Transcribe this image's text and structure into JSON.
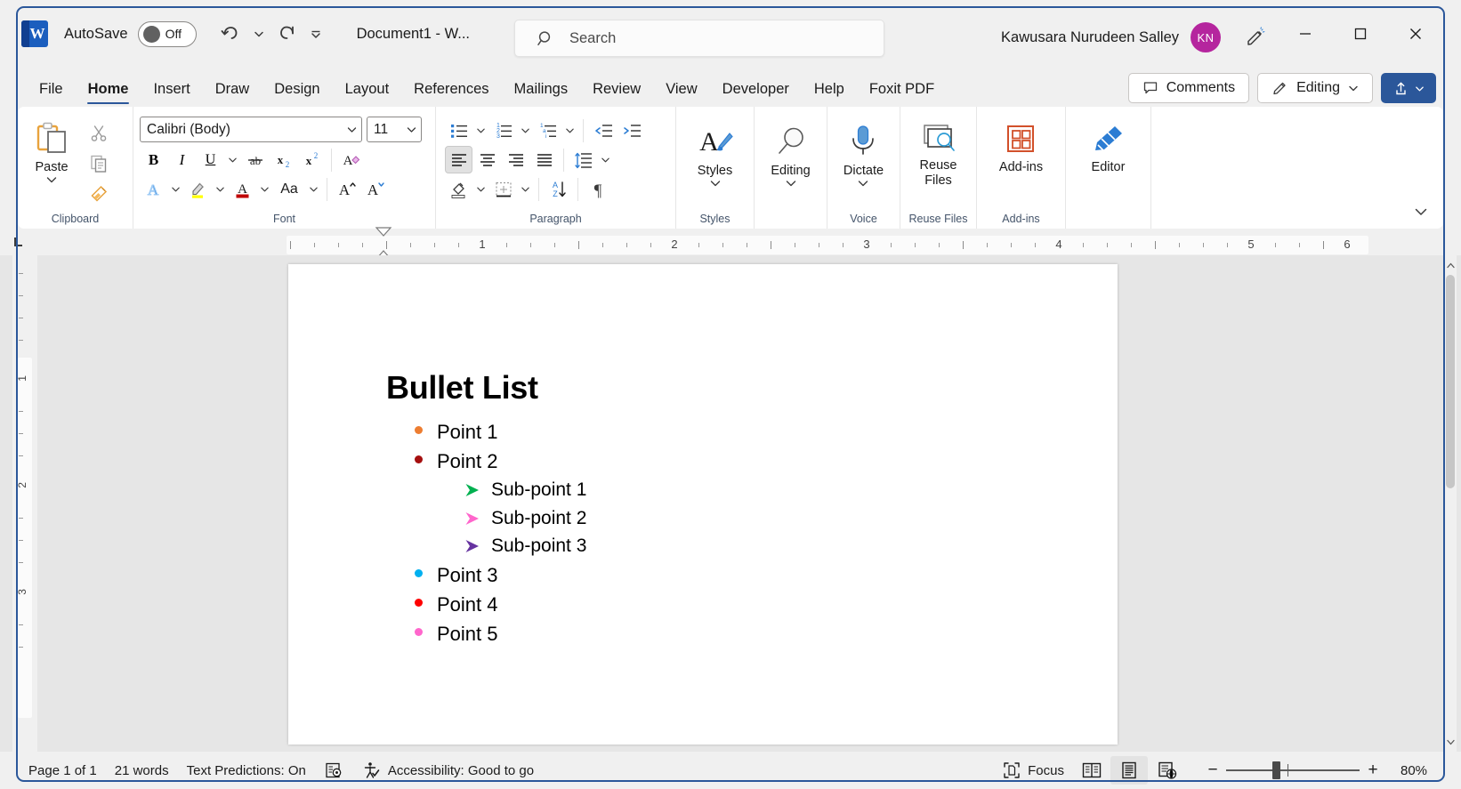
{
  "titlebar": {
    "app_icon": "word-logo",
    "autosave_label": "AutoSave",
    "autosave_state": "Off",
    "undo_icon": "undo-icon",
    "redo_icon": "redo-icon",
    "customize_qat_icon": "customize-quick-access-toolbar-icon",
    "document_title": "Document1  -  W...",
    "search_placeholder": "Search",
    "search_icon": "search-icon",
    "user_name": "Kawusara Nurudeen Salley",
    "avatar_initials": "KN",
    "avatar_color": "#b5259e",
    "ribbon_display_icon": "ribbon-display-options-icon",
    "minimize_label": "Minimize",
    "maximize_label": "Maximize",
    "close_label": "Close"
  },
  "tabs": [
    {
      "label": "File",
      "active": false
    },
    {
      "label": "Home",
      "active": true
    },
    {
      "label": "Insert",
      "active": false
    },
    {
      "label": "Draw",
      "active": false
    },
    {
      "label": "Design",
      "active": false
    },
    {
      "label": "Layout",
      "active": false
    },
    {
      "label": "References",
      "active": false
    },
    {
      "label": "Mailings",
      "active": false
    },
    {
      "label": "Review",
      "active": false
    },
    {
      "label": "View",
      "active": false
    },
    {
      "label": "Developer",
      "active": false
    },
    {
      "label": "Help",
      "active": false
    },
    {
      "label": "Foxit PDF",
      "active": false
    }
  ],
  "tab_actions": {
    "comments_label": "Comments",
    "comments_icon": "comment-icon",
    "editing_label": "Editing",
    "editing_icon": "pencil-icon",
    "editing_caret": "chevron-down-icon",
    "share_icon": "share-icon",
    "share_caret": "chevron-down-icon"
  },
  "ribbon": {
    "collapse_icon": "chevron-down-icon",
    "groups": [
      {
        "name": "Clipboard",
        "label": "Clipboard",
        "dialog_launcher": true,
        "paste_label": "Paste",
        "cut_icon": "scissors-icon",
        "copy_icon": "copy-icon",
        "format_painter_icon": "format-painter-icon"
      },
      {
        "name": "Font",
        "label": "Font",
        "dialog_launcher": true,
        "font_family": "Calibri (Body)",
        "font_size": "11",
        "bold": "B",
        "italic": "I",
        "underline": "U",
        "strikethrough_icon": "strikethrough-icon",
        "subscript_icon": "subscript-icon",
        "superscript_icon": "superscript-icon",
        "clear_formatting_icon": "clear-formatting-icon",
        "text_effects_icon": "text-effects-icon",
        "highlight_icon": "text-highlight-color-icon",
        "font_color_icon": "font-color-icon",
        "change_case_label": "Aa",
        "grow_font_icon": "increase-font-size-icon",
        "shrink_font_icon": "decrease-font-size-icon"
      },
      {
        "name": "Paragraph",
        "label": "Paragraph",
        "dialog_launcher": true,
        "bullets_icon": "bullets-icon",
        "numbering_icon": "numbering-icon",
        "multilevel_icon": "multilevel-list-icon",
        "decrease_indent_icon": "decrease-indent-icon",
        "increase_indent_icon": "increase-indent-icon",
        "align_left_icon": "align-left-icon",
        "align_center_icon": "align-center-icon",
        "align_right_icon": "align-right-icon",
        "justify_icon": "justify-icon",
        "line_spacing_icon": "line-spacing-icon",
        "shading_icon": "shading-icon",
        "borders_icon": "borders-icon",
        "sort_icon": "sort-icon",
        "show_marks_icon": "show-formatting-marks-icon"
      },
      {
        "name": "Styles",
        "label": "Styles",
        "dialog_launcher": true,
        "button_label": "Styles",
        "icon": "styles-icon"
      },
      {
        "name": "Editing",
        "label": "",
        "dialog_launcher": false,
        "button_label": "Editing",
        "icon": "magnifier-icon"
      },
      {
        "name": "Voice",
        "label": "Voice",
        "dialog_launcher": false,
        "button_label": "Dictate",
        "icon": "microphone-icon"
      },
      {
        "name": "Reuse Files",
        "label": "Reuse Files",
        "dialog_launcher": false,
        "button_label": "Reuse Files",
        "icon": "reuse-files-icon"
      },
      {
        "name": "Add-ins",
        "label": "Add-ins",
        "dialog_launcher": false,
        "button_label": "Add-ins",
        "icon": "add-ins-icon"
      },
      {
        "name": "Editor",
        "label": "",
        "dialog_launcher": false,
        "button_label": "Editor",
        "icon": "editor-pen-icon"
      }
    ]
  },
  "ruler": {
    "h_numbers": [
      "1",
      "2",
      "3",
      "4",
      "5",
      "6"
    ],
    "v_numbers": [
      "1",
      "2",
      "3"
    ],
    "left_indent_marker": "first-line-indent-marker",
    "hanging_indent_marker": "hanging-indent-marker"
  },
  "document": {
    "heading": "Bullet List",
    "items": [
      {
        "text": "Point 1",
        "level": 1,
        "bullet": "dot",
        "color": "#ed7d31"
      },
      {
        "text": "Point 2",
        "level": 1,
        "bullet": "dot",
        "color": "#a50f0f"
      },
      {
        "text": "Sub-point 1",
        "level": 2,
        "bullet": "arrow",
        "color": "#00b050"
      },
      {
        "text": "Sub-point 2",
        "level": 2,
        "bullet": "arrow",
        "color": "#ff66cc"
      },
      {
        "text": "Sub-point 3",
        "level": 2,
        "bullet": "arrow",
        "color": "#6633a0"
      },
      {
        "text": "Point 3",
        "level": 1,
        "bullet": "dot",
        "color": "#00b0f0"
      },
      {
        "text": "Point 4",
        "level": 1,
        "bullet": "dot",
        "color": "#fe0000"
      },
      {
        "text": "Point 5",
        "level": 1,
        "bullet": "dot",
        "color": "#ff66cc"
      }
    ]
  },
  "statusbar": {
    "page": "Page 1 of 1",
    "words": "21 words",
    "text_predictions": "Text Predictions: On",
    "editor_icon": "proofing-editor-icon",
    "accessibility_icon": "accessibility-icon",
    "accessibility": "Accessibility: Good to go",
    "focus_label": "Focus",
    "focus_icon": "focus-mode-icon",
    "read_mode_icon": "read-mode-icon",
    "print_layout_icon": "print-layout-icon",
    "web_layout_icon": "web-layout-icon",
    "zoom_out_label": "−",
    "zoom_in_label": "+",
    "zoom_level": "80%"
  }
}
